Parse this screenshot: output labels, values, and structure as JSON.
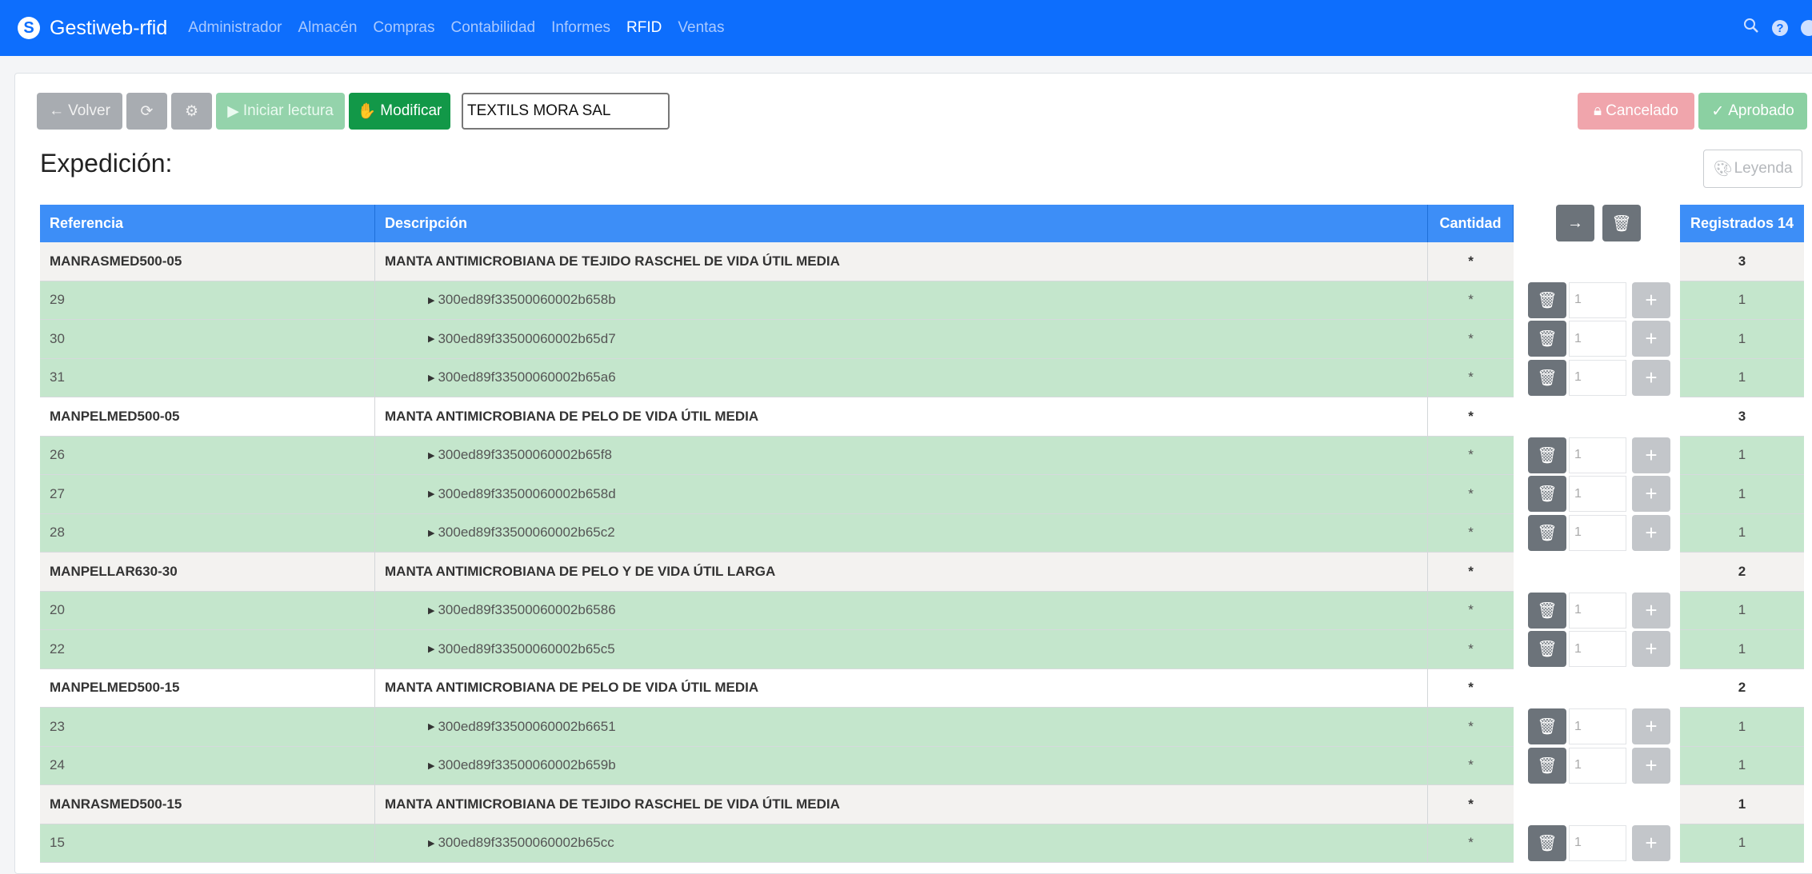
{
  "app": {
    "brand": "Gestiweb-rfid",
    "nav": [
      "Administrador",
      "Almacén",
      "Compras",
      "Contabilidad",
      "Informes",
      "RFID",
      "Ventas"
    ],
    "active_nav": "RFID"
  },
  "toolbar": {
    "back_label": "Volver",
    "start_reading_label": "Iniciar lectura",
    "modify_label": "Modificar",
    "client_value": "TEXTILS MORA SAL",
    "cancelled_label": "Cancelado",
    "approved_label": "Aprobado"
  },
  "page": {
    "title": "Expedición:",
    "legend_label": "Leyenda"
  },
  "table": {
    "headers": {
      "reference": "Referencia",
      "description": "Descripción",
      "quantity": "Cantidad",
      "registered": "Registrados 14"
    },
    "rows": [
      {
        "type": "group",
        "ref": "MANRASMED500-05",
        "desc": "MANTA ANTIMICROBIANA DE TEJIDO RASCHEL DE VIDA ÚTIL MEDIA",
        "qty": "*",
        "reg": "3"
      },
      {
        "type": "item",
        "ref": "29",
        "desc": "300ed89f33500060002b658b",
        "qty": "*",
        "input": "1",
        "reg": "1"
      },
      {
        "type": "item",
        "ref": "30",
        "desc": "300ed89f33500060002b65d7",
        "qty": "*",
        "input": "1",
        "reg": "1"
      },
      {
        "type": "item",
        "ref": "31",
        "desc": "300ed89f33500060002b65a6",
        "qty": "*",
        "input": "1",
        "reg": "1"
      },
      {
        "type": "group",
        "ref": "MANPELMED500-05",
        "desc": "MANTA ANTIMICROBIANA DE PELO DE VIDA ÚTIL MEDIA",
        "qty": "*",
        "reg": "3"
      },
      {
        "type": "item",
        "ref": "26",
        "desc": "300ed89f33500060002b65f8",
        "qty": "*",
        "input": "1",
        "reg": "1"
      },
      {
        "type": "item",
        "ref": "27",
        "desc": "300ed89f33500060002b658d",
        "qty": "*",
        "input": "1",
        "reg": "1"
      },
      {
        "type": "item",
        "ref": "28",
        "desc": "300ed89f33500060002b65c2",
        "qty": "*",
        "input": "1",
        "reg": "1"
      },
      {
        "type": "group",
        "ref": "MANPELLAR630-30",
        "desc": "MANTA ANTIMICROBIANA DE PELO Y DE VIDA ÚTIL LARGA",
        "qty": "*",
        "reg": "2"
      },
      {
        "type": "item",
        "ref": "20",
        "desc": "300ed89f33500060002b6586",
        "qty": "*",
        "input": "1",
        "reg": "1"
      },
      {
        "type": "item",
        "ref": "22",
        "desc": "300ed89f33500060002b65c5",
        "qty": "*",
        "input": "1",
        "reg": "1"
      },
      {
        "type": "group",
        "ref": "MANPELMED500-15",
        "desc": "MANTA ANTIMICROBIANA DE PELO DE VIDA ÚTIL MEDIA",
        "qty": "*",
        "reg": "2"
      },
      {
        "type": "item",
        "ref": "23",
        "desc": "300ed89f33500060002b6651",
        "qty": "*",
        "input": "1",
        "reg": "1"
      },
      {
        "type": "item",
        "ref": "24",
        "desc": "300ed89f33500060002b659b",
        "qty": "*",
        "input": "1",
        "reg": "1"
      },
      {
        "type": "group",
        "ref": "MANRASMED500-15",
        "desc": "MANTA ANTIMICROBIANA DE TEJIDO RASCHEL DE VIDA ÚTIL MEDIA",
        "qty": "*",
        "reg": "1"
      },
      {
        "type": "item",
        "ref": "15",
        "desc": "300ed89f33500060002b65cc",
        "qty": "*",
        "input": "1",
        "reg": "1"
      }
    ]
  },
  "icons": {
    "search": "search-icon",
    "help": "help-icon",
    "user": "user-icon",
    "back": "arrow-left-icon",
    "refresh": "refresh-icon",
    "settings": "gear-icon",
    "play": "play-icon",
    "hand": "hand-icon",
    "lock": "lock-icon",
    "check": "check-icon",
    "palette": "palette-icon",
    "arrow_right": "arrow-right-icon",
    "trash": "trash-icon",
    "plus": "plus-icon"
  },
  "colors": {
    "primary": "#0d6efd",
    "header_blue": "#3d8ef7",
    "item_green": "#c4e6cc",
    "modify_green": "#129848"
  }
}
